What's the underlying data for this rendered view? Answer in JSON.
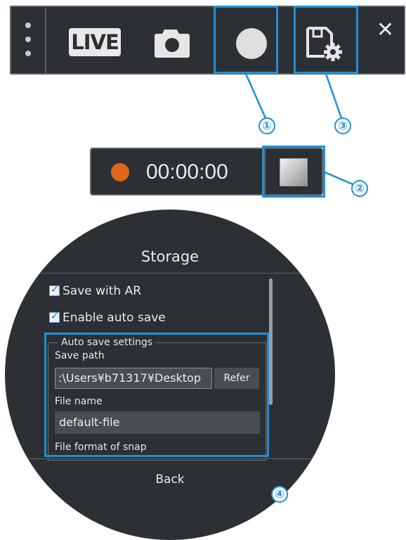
{
  "toolbar": {
    "live_label": "LIVE",
    "close_label": "✕",
    "icons": [
      "more-vertical-icon",
      "live-icon",
      "camera-icon",
      "record-icon",
      "save-settings-icon",
      "close-icon"
    ]
  },
  "record_bar": {
    "time": "00:00:00",
    "icons": [
      "recording-indicator-icon",
      "stop-icon"
    ]
  },
  "storage": {
    "title": "Storage",
    "save_with_ar": {
      "label": "Save with AR",
      "checked": true
    },
    "enable_auto_save": {
      "label": "Enable auto save",
      "checked": true
    },
    "auto_save_settings": {
      "legend": "Auto save settings",
      "save_path_label": "Save path",
      "save_path_value": ":\\Users¥b71317¥Desktop",
      "refer_button": "Refer",
      "file_name_label": "File name",
      "file_name_value": "default-file",
      "file_format_label": "File format of snap"
    },
    "back_button": "Back"
  },
  "callouts": [
    "①",
    "②",
    "③",
    "④"
  ],
  "colors": {
    "panel_bg": "#2c2f33",
    "highlight": "#1e90d8",
    "record_dot": "#e0661a",
    "text": "#e9e9e9"
  }
}
